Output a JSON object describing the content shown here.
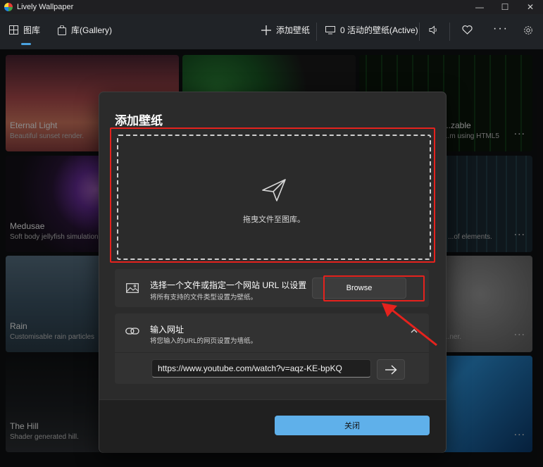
{
  "window": {
    "title": "Lively Wallpaper",
    "controls": {
      "minimize": "—",
      "maximize": "☐",
      "close": "✕"
    }
  },
  "nav": {
    "library_label": "图库",
    "gallery_label": "库(Gallery)",
    "add_label": "添加壁纸",
    "active_label": "0 活动的壁纸(Active)"
  },
  "tiles": [
    {
      "title": "Eternal Light",
      "desc": "Beautiful sunset render."
    },
    {
      "title": "Medusae",
      "desc": "Soft body jellyfish simulation"
    },
    {
      "title": "Rain",
      "desc": "Customisable rain particles"
    },
    {
      "title": "The Hill",
      "desc": "Shader generated hill."
    },
    {
      "title": "...zable",
      "desc": "...m using HTML5"
    },
    {
      "title": "",
      "desc": "...of elements."
    },
    {
      "title": "",
      "desc": "...ner."
    }
  ],
  "tile_more": "...",
  "dialog": {
    "title": "添加壁纸",
    "drop_text": "拖曳文件至图库。",
    "file_card": {
      "title": "选择一个文件或指定一个网站 URL 以设置",
      "subtitle": "将所有支持的文件类型设置为壁纸。",
      "browse": "Browse"
    },
    "url_card": {
      "title": "输入网址",
      "subtitle": "将您输入的URL的网页设置为墙纸。",
      "url_value": "https://www.youtube.com/watch?v=aqz-KE-bpKQ"
    },
    "close": "关闭"
  },
  "colors": {
    "accent": "#5fb0ea",
    "highlight": "#e5221d",
    "dialog_bg": "#2b2b2b"
  }
}
